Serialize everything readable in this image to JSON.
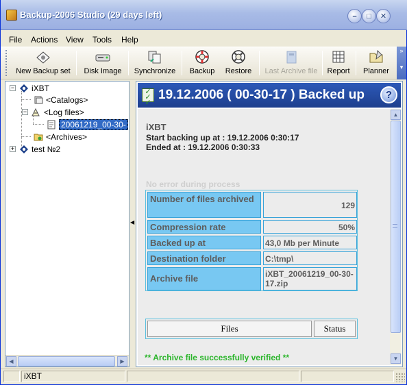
{
  "window": {
    "title": "Backup-2006 Studio (29 days left)"
  },
  "menu": [
    "File",
    "Actions",
    "View",
    "Tools",
    "Help"
  ],
  "toolbar": [
    {
      "label": "New Backup set",
      "icon": "new-backup-icon",
      "enabled": true
    },
    {
      "label": "Disk Image",
      "icon": "disk-image-icon",
      "enabled": true
    },
    {
      "label": "Synchronize",
      "icon": "synchronize-icon",
      "enabled": true
    },
    {
      "label": "Backup",
      "icon": "lifebuoy-icon",
      "enabled": true
    },
    {
      "label": "Restore",
      "icon": "restore-icon",
      "enabled": true
    },
    {
      "label": "Last Archive file",
      "icon": "archive-icon",
      "enabled": false
    },
    {
      "label": "Report",
      "icon": "report-icon",
      "enabled": true
    },
    {
      "label": "Planner",
      "icon": "planner-icon",
      "enabled": true
    }
  ],
  "tree": {
    "root1": "iXBT",
    "catalogs": "<Catalogs>",
    "logfiles": "<Log files>",
    "logfile_selected": "20061219_00-30-",
    "archives": "<Archives>",
    "root2": "test №2"
  },
  "report": {
    "header": "19.12.2006 ( 00-30-17 ) Backed up",
    "set_name": "iXBT",
    "start": "Start backing up at : 19.12.2006 0:30:17",
    "end": "Ended at : 19.12.2006 0:30:33",
    "no_error": "No error during process",
    "stats": [
      {
        "label": "Number of files archived",
        "value": "129"
      },
      {
        "label": "Compression rate",
        "value": "50%"
      },
      {
        "label": "Backed up at",
        "value": "43,0 Mb per Minute"
      },
      {
        "label": "Destination folder",
        "value": "C:\\tmp\\"
      },
      {
        "label": "Archive file",
        "value": "iXBT_20061219_00-30-17.zip"
      }
    ],
    "files_header": "Files",
    "status_header": "Status",
    "verified": "** Archive file successfully verified **"
  },
  "status": {
    "panel1": "iXBT"
  },
  "colors": {
    "header_bg": "#2c59b8",
    "label_cell": "#78c8f2",
    "success": "#2bb52b"
  }
}
